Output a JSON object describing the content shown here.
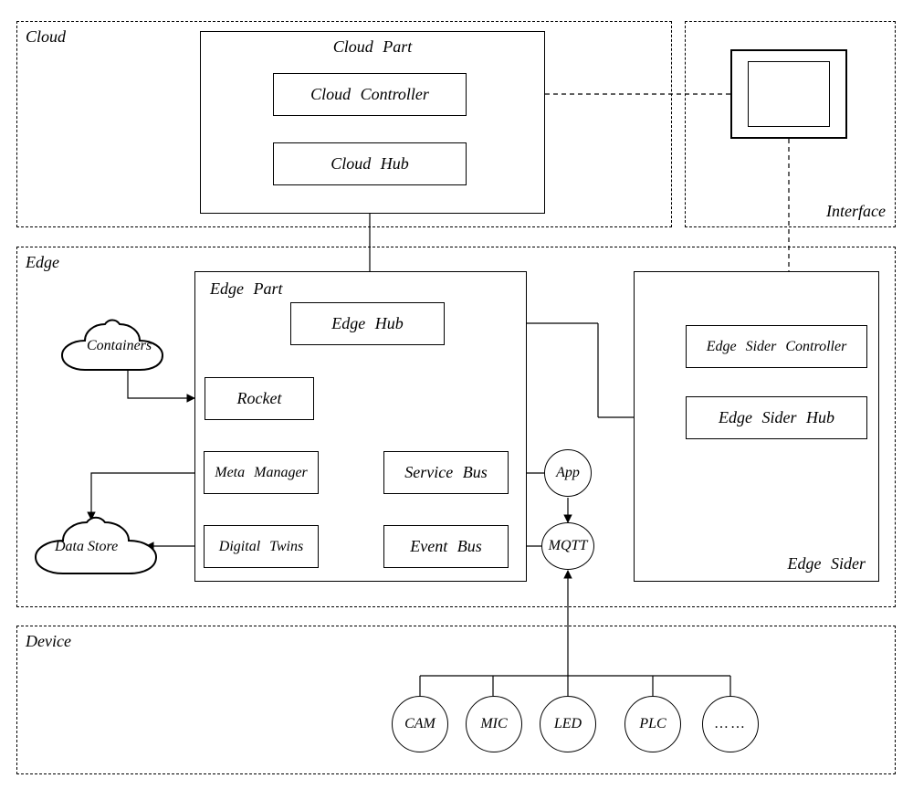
{
  "layers": {
    "cloud": {
      "label": "Cloud"
    },
    "interface": {
      "label": "Interface"
    },
    "edge": {
      "label": "Edge"
    },
    "device": {
      "label": "Device"
    }
  },
  "cloud_part": {
    "title": "Cloud   Part",
    "controller": "Cloud   Controller",
    "hub": "Cloud   Hub"
  },
  "edge_part": {
    "title": "Edge   Part",
    "hub": "Edge   Hub",
    "rocket": "Rocket",
    "meta_manager": "Meta   Manager",
    "service_bus": "Service   Bus",
    "digital_twins": "Digital   Twins",
    "event_bus": "Event   Bus"
  },
  "edge_sider": {
    "title": "Edge   Sider",
    "controller": "Edge   Sider   Controller",
    "hub": "Edge   Sider   Hub"
  },
  "clouds": {
    "containers": "Containers",
    "data_store": "Data  Store"
  },
  "bubbles": {
    "app": "App",
    "mqtt": "MQTT"
  },
  "devices": {
    "d1": "CAM",
    "d2": "MIC",
    "d3": "LED",
    "d4": "PLC",
    "d5": "……"
  }
}
